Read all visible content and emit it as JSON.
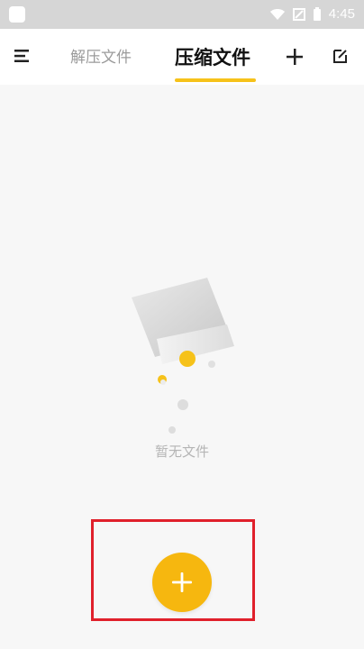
{
  "status_bar": {
    "time": "4:45"
  },
  "topbar": {
    "tabs": [
      {
        "label": "解压文件",
        "active": false
      },
      {
        "label": "压缩文件",
        "active": true
      }
    ],
    "icons": {
      "menu": "menu-icon",
      "add": "plus-icon",
      "edit": "edit-icon"
    },
    "accent_color": "#f6c21a"
  },
  "empty_state": {
    "message": "暂无文件"
  },
  "fab": {
    "icon": "plus-icon",
    "color": "#f6b70f"
  },
  "highlight": {
    "color": "#e0202b"
  }
}
